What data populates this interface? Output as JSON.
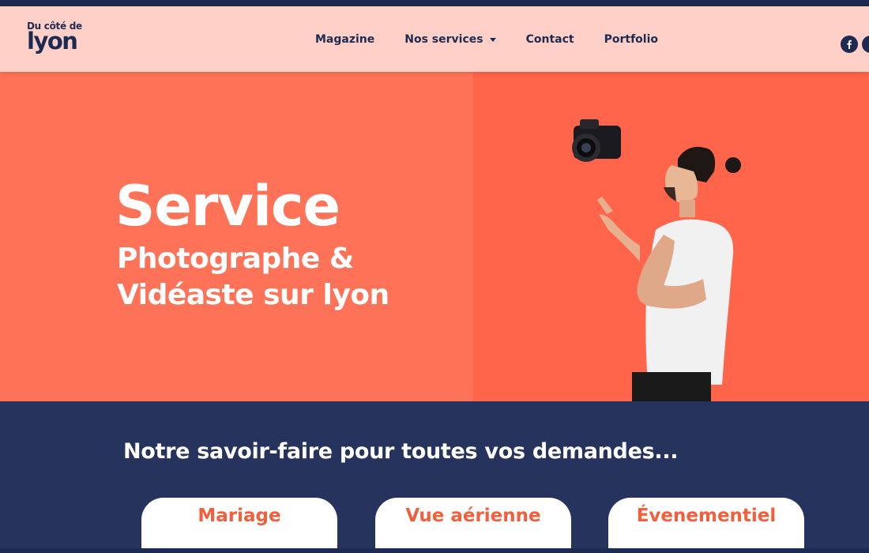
{
  "header": {
    "logo": {
      "top": "Du côté de",
      "bottom": "lyon"
    },
    "nav": [
      {
        "label": "Magazine"
      },
      {
        "label": "Nos services"
      },
      {
        "label": "Contact"
      },
      {
        "label": "Portfolio"
      }
    ],
    "social": {
      "facebook_icon": "facebook-icon",
      "instagram_icon": "instagram-icon"
    }
  },
  "hero": {
    "title": "Service",
    "subtitle_line1": "Photographe &",
    "subtitle_line2": "Vidéaste sur lyon"
  },
  "section": {
    "title": "Notre savoir-faire pour toutes vos demandes...",
    "cards": [
      {
        "label": "Mariage"
      },
      {
        "label": "Vue aérienne"
      },
      {
        "label": "Évenementiel"
      }
    ]
  },
  "colors": {
    "navy": "#1d2b52",
    "header_bg": "#ffd0c8",
    "coral_left": "#fe7358",
    "coral_right": "#fe654b",
    "card_label": "#f0603f"
  }
}
